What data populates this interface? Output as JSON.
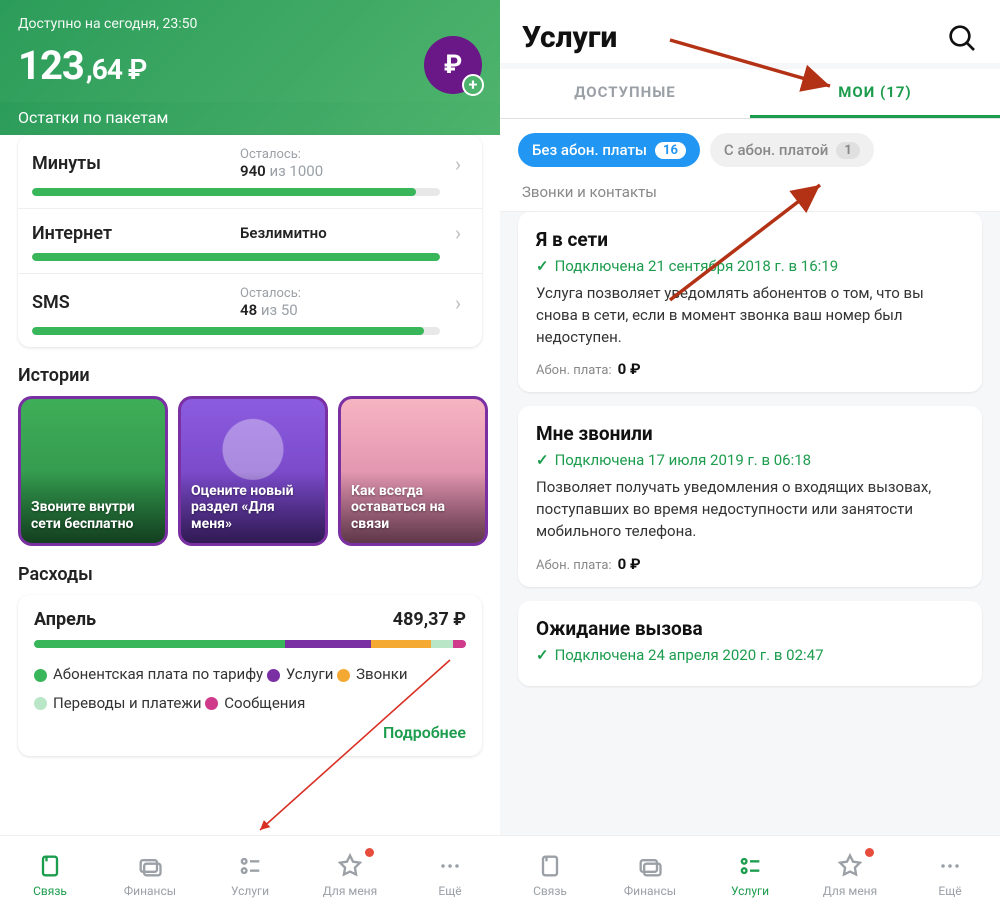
{
  "left": {
    "avail_label": "Доступно на сегодня, 23:50",
    "balance_main": "123",
    "balance_frac": ",64",
    "balance_cur": "₽",
    "packets_title": "Остатки по пакетам",
    "packets": [
      {
        "name": "Минуты",
        "lbl": "Осталось:",
        "val": "940",
        "of": " из 1000",
        "pct": 94
      },
      {
        "name": "Интернет",
        "lbl": "",
        "val": "Безлимитно",
        "of": "",
        "pct": 100
      },
      {
        "name": "SMS",
        "lbl": "Осталось:",
        "val": "48",
        "of": " из 50",
        "pct": 96
      }
    ],
    "stories_title": "Истории",
    "stories": [
      "Звоните внутри сети бесплатно",
      "Оцените новый раздел «Для меня»",
      "Как всегда оставаться на связи"
    ],
    "exp_title": "Расходы",
    "exp_month": "Апрель",
    "exp_amount": "489,37 ₽",
    "exp_segments": [
      {
        "color": "#39b55a",
        "w": 58
      },
      {
        "color": "#7a2fa3",
        "w": 20
      },
      {
        "color": "#f4a933",
        "w": 14
      },
      {
        "color": "#b9e6c7",
        "w": 5
      },
      {
        "color": "#d03a8a",
        "w": 3
      }
    ],
    "exp_legend": [
      {
        "color": "#39b55a",
        "text": "Абонентская плата по тарифу"
      },
      {
        "color": "#7a2fa3",
        "text": "Услуги"
      },
      {
        "color": "#f4a933",
        "text": "Звонки"
      },
      {
        "color": "#b9e6c7",
        "text": "Переводы и платежи"
      },
      {
        "color": "#d03a8a",
        "text": "Сообщения"
      }
    ],
    "exp_more": "Подробнее",
    "tabs": [
      "Связь",
      "Финансы",
      "Услуги",
      "Для меня",
      "Ещё"
    ],
    "active_tab": 0,
    "highlight_tab": 2
  },
  "right": {
    "title": "Услуги",
    "tabs": {
      "available": "ДОСТУПНЫЕ",
      "mine": "МОИ (17)"
    },
    "chips": [
      {
        "label": "Без абон. платы",
        "count": "16",
        "on": true
      },
      {
        "label": "С абон. платой",
        "count": "1",
        "on": false
      }
    ],
    "category": "Звонки и контакты",
    "services": [
      {
        "title": "Я в сети",
        "status": "Подключена 21 сентября 2018 г. в 16:19",
        "desc": "Услуга позволяет уведомлять абонентов о том, что вы снова в сети, если в момент звонка ваш номер был недоступен.",
        "fee_label": "Абон. плата:",
        "fee_val": "0 ₽"
      },
      {
        "title": "Мне звонили",
        "status": "Подключена 17 июля 2019 г. в 06:18",
        "desc": "Позволяет получать уведомления о входящих вызовах, поступавших во время недоступности или занятости мобильного телефона.",
        "fee_label": "Абон. плата:",
        "fee_val": "0 ₽"
      },
      {
        "title": "Ожидание вызова",
        "status": "Подключена 24 апреля 2020 г. в 02:47",
        "desc": "",
        "fee_label": "",
        "fee_val": ""
      }
    ],
    "tabs_bottom": [
      "Связь",
      "Финансы",
      "Услуги",
      "Для меня",
      "Ещё"
    ],
    "active_tab": 2
  }
}
